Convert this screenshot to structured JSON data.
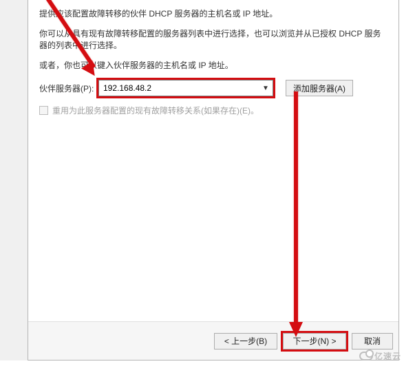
{
  "instructions": {
    "line1": "提供应该配置故障转移的伙伴 DHCP 服务器的主机名或 IP 地址。",
    "line2": "你可以从具有现有故障转移配置的服务器列表中进行选择，也可以浏览并从已授权 DHCP 服务器的列表中进行选择。",
    "line3": "或者，你也可以键入伙伴服务器的主机名或 IP 地址。"
  },
  "form": {
    "partner_label": "伙伴服务器(P):",
    "partner_value": "192.168.48.2",
    "add_server_label": "添加服务器(A)",
    "reuse_label": "重用为此服务器配置的现有故障转移关系(如果存在)(E)。"
  },
  "buttons": {
    "back": "< 上一步(B)",
    "next": "下一步(N) >",
    "cancel": "取消"
  },
  "watermark": "亿速云",
  "annotation_color": "#d40d11"
}
